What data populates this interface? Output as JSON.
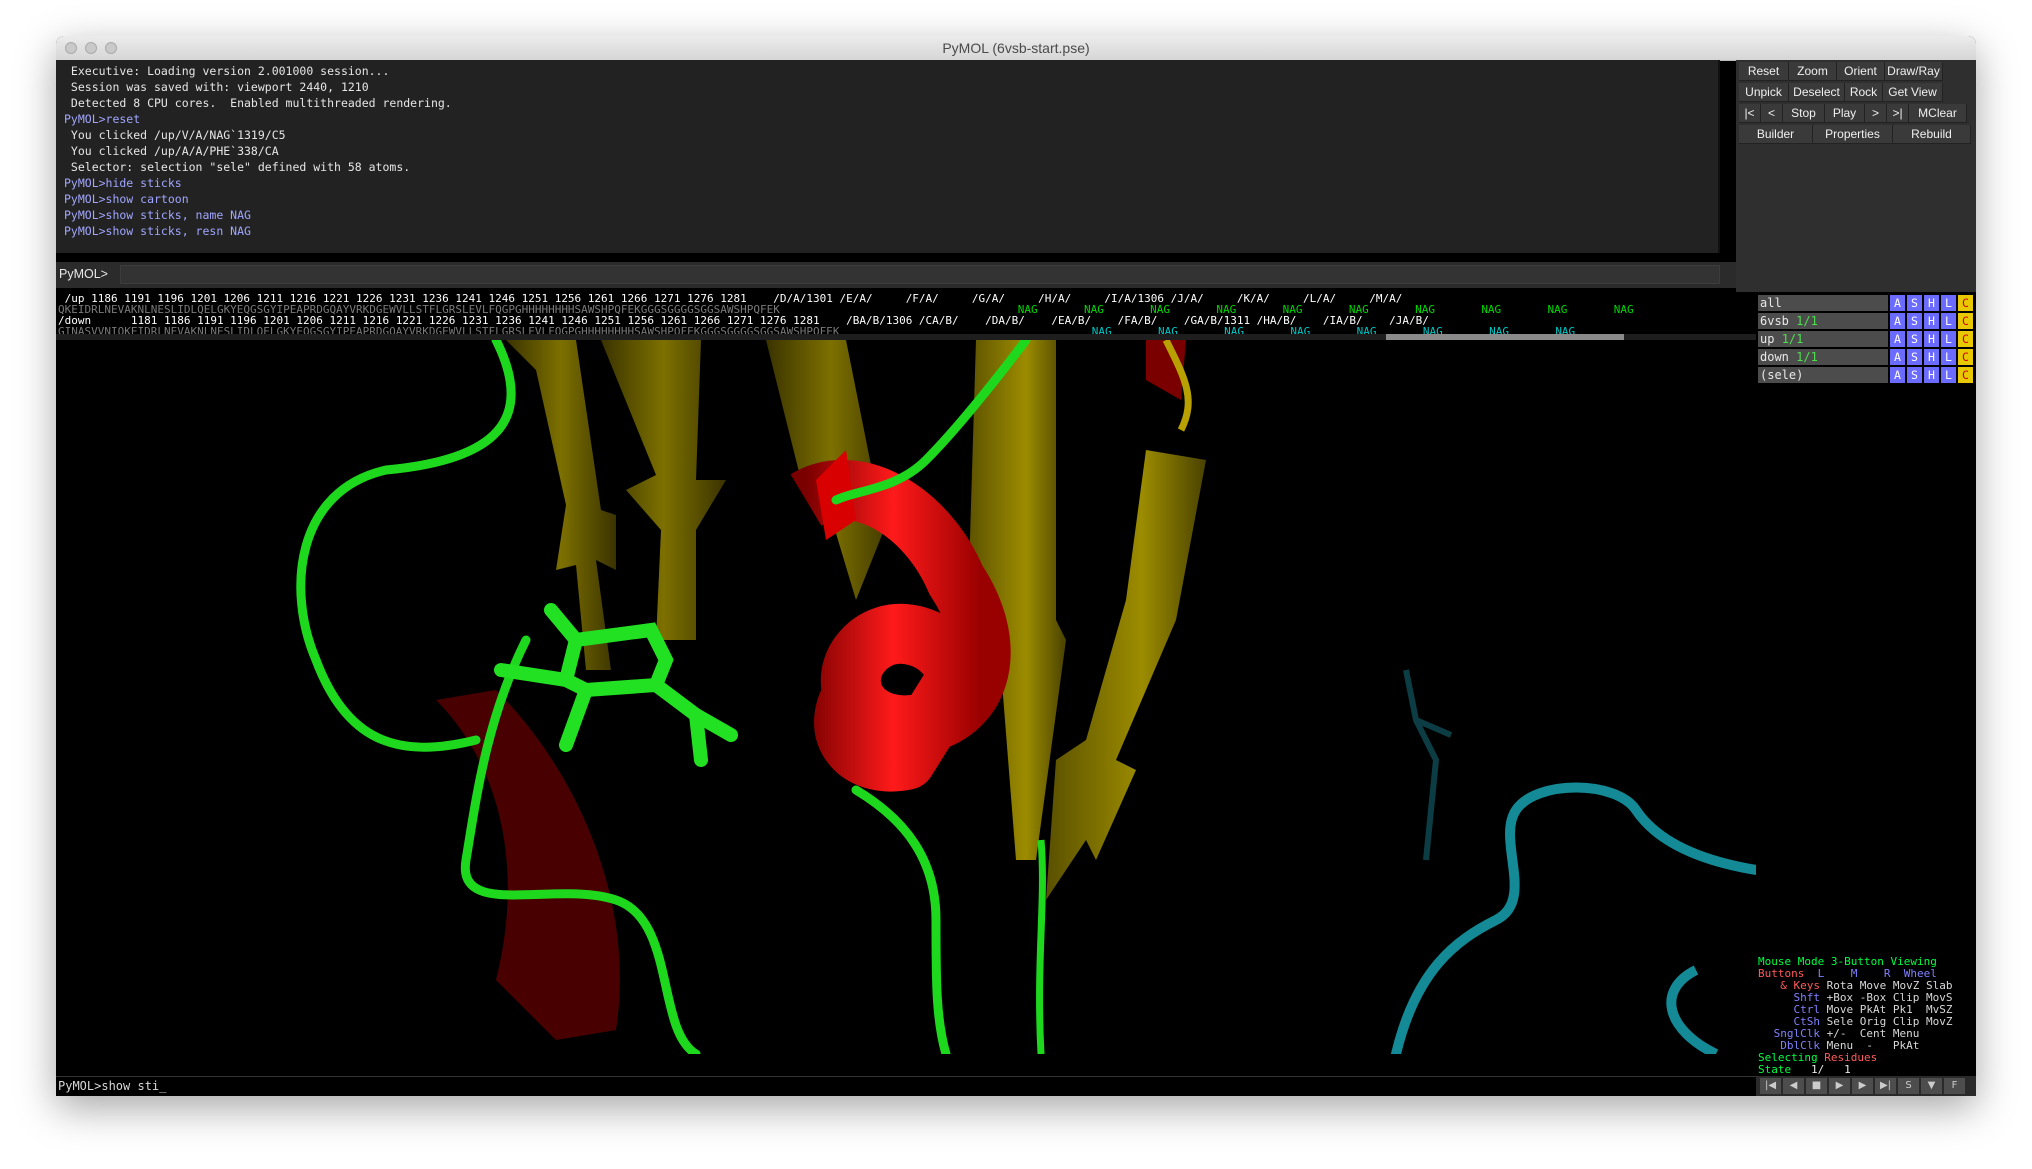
{
  "window": {
    "title": "PyMOL (6vsb-start.pse)"
  },
  "log": {
    "lines": [
      {
        "text": " Executive: Loading version 2.001000 session...",
        "type": "out"
      },
      {
        "text": " Session was saved with: viewport 2440, 1210",
        "type": "out"
      },
      {
        "text": " Detected 8 CPU cores.  Enabled multithreaded rendering.",
        "type": "out"
      },
      {
        "text": "PyMOL>reset",
        "type": "cmd"
      },
      {
        "text": " You clicked /up/V/A/NAG`1319/C5",
        "type": "out"
      },
      {
        "text": " You clicked /up/A/A/PHE`338/CA",
        "type": "out"
      },
      {
        "text": " Selector: selection \"sele\" defined with 58 atoms.",
        "type": "out"
      },
      {
        "text": "PyMOL>hide sticks",
        "type": "cmd"
      },
      {
        "text": "PyMOL>show cartoon",
        "type": "cmd"
      },
      {
        "text": "PyMOL>show sticks, name NAG",
        "type": "cmd"
      },
      {
        "text": "PyMOL>show sticks, resn NAG",
        "type": "cmd"
      }
    ]
  },
  "buttons": {
    "row1": [
      "Reset",
      "Zoom",
      "Orient",
      "Draw/Ray"
    ],
    "row2": [
      "Unpick",
      "Deselect",
      "Rock",
      "Get View"
    ],
    "row3": [
      "|<",
      "<",
      "Stop",
      "Play",
      ">",
      ">|",
      "MClear"
    ],
    "row4": [
      "Builder",
      "Properties",
      "Rebuild"
    ]
  },
  "command": {
    "label": "PyMOL>",
    "value": ""
  },
  "sequence": {
    "up_header": " /up 1186 1191 1196 1201 1206 1211 1216 1221 1226 1231 1236 1241 1246 1251 1256 1261 1266 1271 1276 1281    /D/A/1301 /E/A/     /F/A/     /G/A/     /H/A/     /I/A/1306 /J/A/     /K/A/     /L/A/     /M/A/",
    "up_seq": "QKEIDRLNEVAKNLNESLIDLQELGKYEQGSGYIPEAPRDGQAYVRKDGEWVLLSTFLGRSLEVLFQGPGHHHHHHHHSAWSHPQFEKGGGSGGGGSGGSAWSHPQFEK",
    "up_nag": "      NAG       NAG       NAG       NAG       NAG       NAG       NAG       NAG       NAG       NAG",
    "down_header": "/down      1181 1186 1191 1196 1201 1206 1211 1216 1221 1226 1231 1236 1241 1246 1251 1256 1261 1266 1271 1276 1281    /BA/B/1306 /CA/B/    /DA/B/    /EA/B/    /FA/B/    /GA/B/1311 /HA/B/    /IA/B/    /JA/B/",
    "down_seq": "GINASVVNIQKEIDRLNEVAKNLNESLIDLQELGKYEQGSGYIPEAPRDGQAYVRKDGEWVLLSTFLGRSLEVLFQGPGHHHHHHHHSAWSHPQFEKGGGSGGGGSGGSAWSHPQFEK",
    "down_nag": "      NAG       NAG       NAG       NAG       NAG       NAG       NAG       NAG"
  },
  "objects": [
    {
      "name": "all",
      "state": ""
    },
    {
      "name": "6vsb",
      "state": "1/1"
    },
    {
      "name": "up",
      "state": "1/1"
    },
    {
      "name": "down",
      "state": "1/1"
    },
    {
      "name": "(sele)",
      "state": ""
    }
  ],
  "object_actions": [
    "A",
    "S",
    "H",
    "L",
    "C"
  ],
  "mouse_mode": {
    "title_left": "Mouse Mode",
    "title_right": "3-Button Viewing",
    "buttons_label": "Buttons",
    "buttons_cols": "L    M    R  Wheel",
    "rows": [
      {
        "key": "& Keys",
        "vals": "Rota Move MovZ Slab"
      },
      {
        "key": "Shft",
        "vals": "+Box -Box Clip MovS"
      },
      {
        "key": "Ctrl",
        "vals": "Move PkAt Pk1  MvSZ"
      },
      {
        "key": "CtSh",
        "vals": "Sele Orig Clip MovZ"
      },
      {
        "key": "SnglClk",
        "vals": "+/-  Cent Menu"
      },
      {
        "key": "DblClk",
        "vals": "Menu  -   PkAt"
      }
    ],
    "selecting_label": "Selecting",
    "selecting_value": "Residues",
    "state_label": "State",
    "state_value": "1/   1"
  },
  "vcr_buttons": [
    "|◀",
    "◀",
    "■",
    "▶",
    "▶",
    "▶|",
    "S",
    "▼",
    "F"
  ],
  "bottom_command": "PyMOL>show sti_",
  "colors": {
    "cmd_text": "#a0a6ff",
    "nag_green": "#00d800",
    "nag_cyan": "#00c8c8",
    "state_green": "#4de04d",
    "btn_A": "#6b6bff",
    "btn_S": "#6b6bff",
    "btn_H": "#6b6bff",
    "btn_L": "#6b6bff",
    "btn_C": "#e8c800"
  }
}
